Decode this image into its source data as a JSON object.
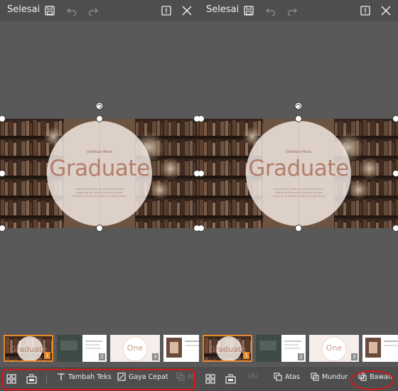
{
  "topbar": {
    "done_label": "Selesai"
  },
  "slide": {
    "title": "Graduate",
    "subtitle": "Dedikasi Masa",
    "body_line1": "Lorem ipsum dolor sit amet consectetur",
    "body_line2": "adipiscing elit sed do eiusmod tempor",
    "body_line3": "incididunt ut labore et dolore magna aliqua"
  },
  "thumbnails": [
    {
      "label": "Graduate",
      "number": "1"
    },
    {
      "label": "",
      "number": "2"
    },
    {
      "label": "One",
      "number": "3"
    },
    {
      "label": "",
      "number": "4"
    }
  ],
  "toolbar_left": {
    "add_text_label": "Tambah Teks",
    "quick_style_label": "Gaya Cepat",
    "cut_off_label": "M"
  },
  "toolbar_right": {
    "cut_off_label": "sfu",
    "front_label": "Atas",
    "backward_label": "Mundur",
    "back_label": "Bawah"
  },
  "colors": {
    "accent": "#e5892b",
    "highlight": "#d8151b",
    "bar": "#4e4e4e",
    "canvas": "#595959"
  }
}
